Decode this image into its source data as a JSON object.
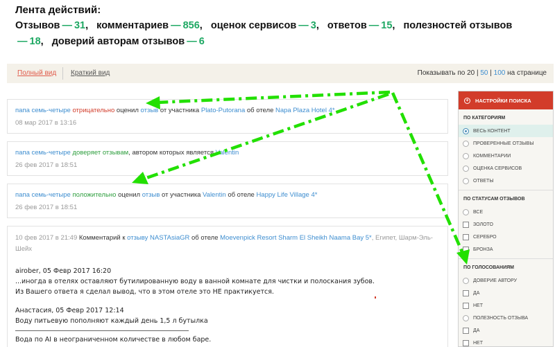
{
  "header": {
    "title": "Лента действий:",
    "stats": [
      {
        "label": "Отзывов",
        "value": "31"
      },
      {
        "label": "комментариев",
        "value": "856"
      },
      {
        "label": "оценок сервисов",
        "value": "3"
      },
      {
        "label": "ответов",
        "value": "15"
      },
      {
        "label": "полезностей отзывов",
        "value": "18"
      },
      {
        "label": "доверий авторам отзывов",
        "value": "6"
      }
    ]
  },
  "viewbar": {
    "full": "Полный вид",
    "short": "Краткий вид",
    "perpage_prefix": "Показывать по",
    "options": [
      "20",
      "50",
      "100"
    ],
    "separator": "|",
    "perpage_suffix": "на странице"
  },
  "feed": [
    {
      "user": "папа семь-четыре",
      "action": "отрицательно",
      "verb": "оценил",
      "object": "отзыв",
      "from": "от участника",
      "author": "Plato-Putorana",
      "about": "об отеле",
      "hotel": "Napa Plaza Hotel 4*",
      "date": "08 мар 2017 в 13:16"
    },
    {
      "user": "папа семь-четыре",
      "action": "доверяет отзывам",
      "rest": ", автором которых является",
      "author": "Valentin",
      "date": "26 фев 2017 в 18:51"
    },
    {
      "user": "папа семь-четыре",
      "action": "положительно",
      "verb": "оценил",
      "object": "отзыв",
      "from": "от участника",
      "author": "Valentin",
      "about": "об отеле",
      "hotel": "Happy Life Village 4*",
      "date": "26 фев 2017 в 18:51"
    }
  ],
  "long_card": {
    "date": "10 фев 2017 в 21:49",
    "label": "Комментарий к",
    "object": "отзыву",
    "author": "NASTAsiaGR",
    "about": "об отеле",
    "hotel": "Moevenpick Resort Sharm El Sheikh Naama Bay 5*",
    "location": ", Египет, Шарм-Эль-Шейх",
    "comment": {
      "q1_author": "airober, 05 Февр 2017 16:20",
      "q1_line1": "...иногда в отелях оставляют бутилированную воду в ванной комнате для чистки и полоскания зубов.",
      "q1_line2": "Из Вашего ответа я сделал вывод, что в этом отеле это НЕ практикуется.",
      "q2_author": "Анастасия, 05 Февр 2017 12:14",
      "q2_line1": "Воду питьевую пополняют каждый день 1,5 л бутылка",
      "q2_line2": "Вода по AI в неограниченном количестве в любом баре."
    }
  },
  "panel": {
    "header": "НАСТРОЙКИ ПОИСКА",
    "categories_title": "ПО КАТЕГОРИЯМ",
    "categories": [
      "ВЕСЬ КОНТЕНТ",
      "ПРОВЕРЕННЫЕ ОТЗЫВЫ",
      "КОММЕНТАРИИ",
      "ОЦЕНКА СЕРВИСОВ",
      "ОТВЕТЫ"
    ],
    "status_title": "ПО СТАТУСАМ ОТЗЫВОВ",
    "statuses": [
      "ВСЕ",
      "ЗОЛОТО",
      "СЕРЕБРО",
      "БРОНЗА"
    ],
    "votes_title": "ПО ГОЛОСОВАНИЯМ",
    "votes": [
      {
        "label": "ДОВЕРИЕ АВТОРУ",
        "kind": "radio"
      },
      {
        "label": "ДА",
        "kind": "check"
      },
      {
        "label": "НЕТ",
        "kind": "check"
      },
      {
        "label": "ПОЛЕЗНОСТЬ ОТЗЫВА",
        "kind": "radio"
      },
      {
        "label": "ДА",
        "kind": "check"
      },
      {
        "label": "НЕТ",
        "kind": "check"
      }
    ]
  },
  "colors": {
    "accent_red": "#d23c2a",
    "link_blue": "#3e8ed0",
    "positive_green": "#2e9e3e",
    "stat_green": "#1ea863",
    "annotation_arrow": "#22e000"
  }
}
